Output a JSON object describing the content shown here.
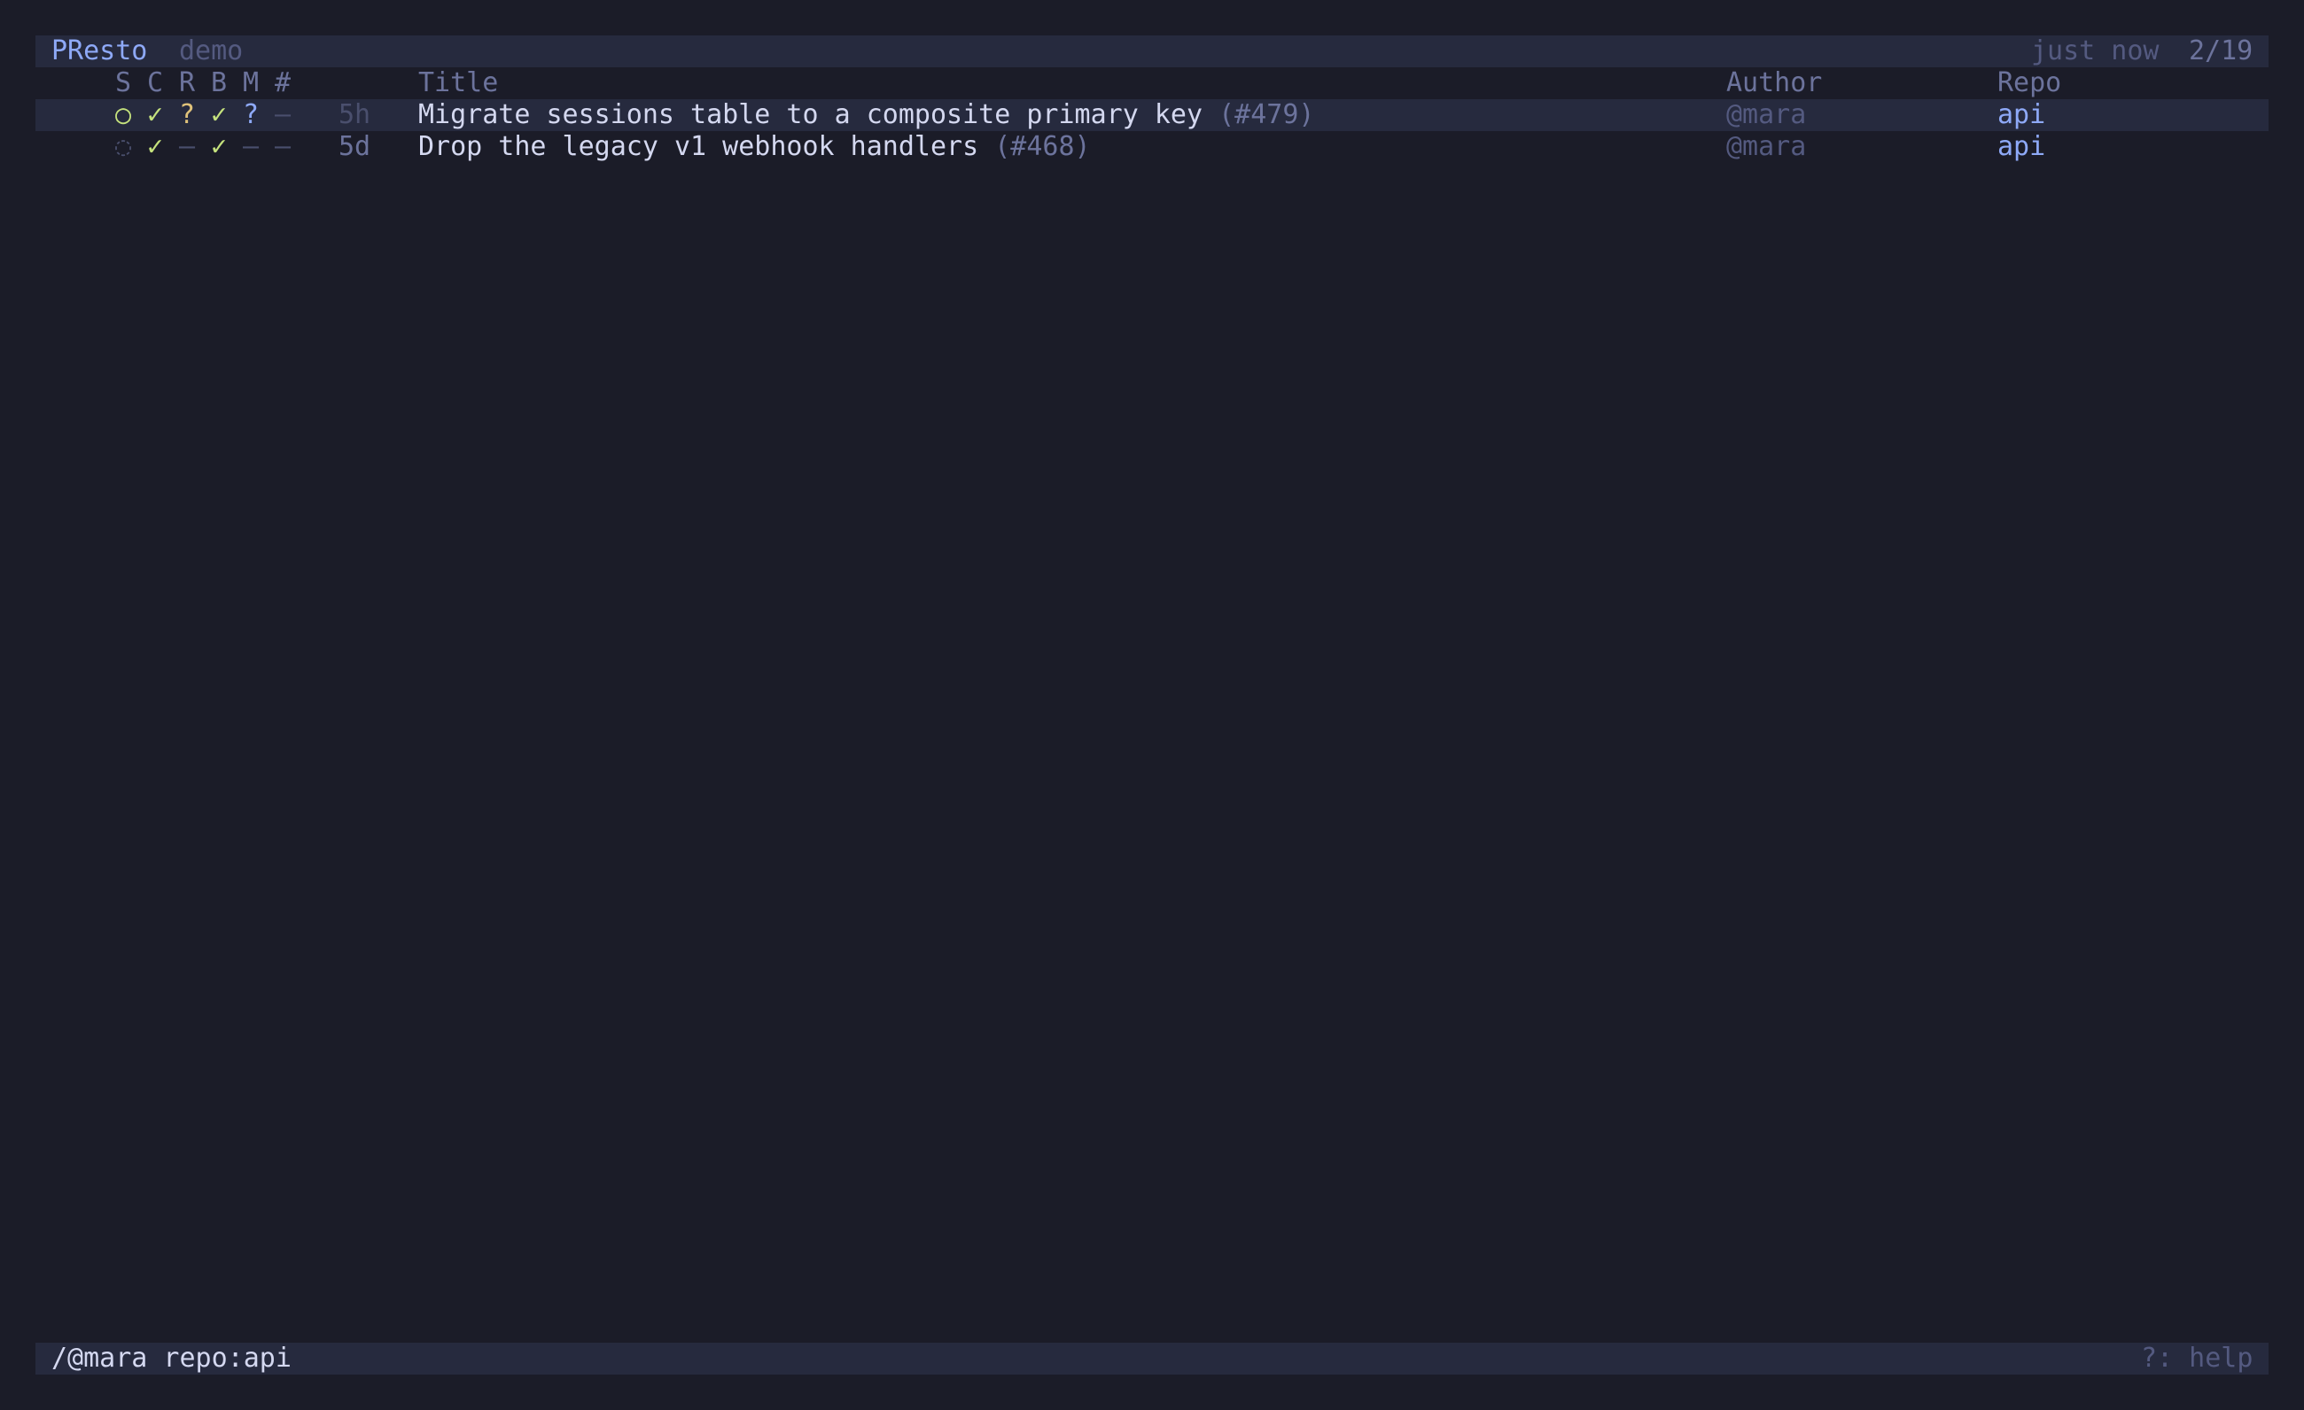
{
  "header": {
    "app_name": "PResto",
    "profile": "demo",
    "refreshed": "just now",
    "position": "2/19"
  },
  "columns": {
    "s": "S",
    "c": "C",
    "r": "R",
    "b": "B",
    "m": "M",
    "num": "#",
    "title": "Title",
    "author": "Author",
    "repo": "Repo"
  },
  "rows": [
    {
      "s": "○",
      "c": "✓",
      "r": "?",
      "b": "✓",
      "m": "?",
      "num": "–",
      "age": "5h",
      "title": "Migrate sessions table to a composite primary key",
      "number": "(#479)",
      "author": "@mara",
      "repo": "api",
      "selected": true
    },
    {
      "s": "◌",
      "c": "✓",
      "r": "–",
      "b": "✓",
      "m": "–",
      "num": "–",
      "age": "5d",
      "title": "Drop the legacy v1 webhook handlers",
      "number": "(#468)",
      "author": "@mara",
      "repo": "api",
      "selected": false
    }
  ],
  "footer": {
    "filter": "/@mara repo:api",
    "help": "?: help"
  },
  "colors": {
    "background": "#1b1c28",
    "bar": "#262a3e",
    "accent": "#8ea9f7",
    "success": "#c5e27d",
    "warning": "#e0c27a"
  }
}
